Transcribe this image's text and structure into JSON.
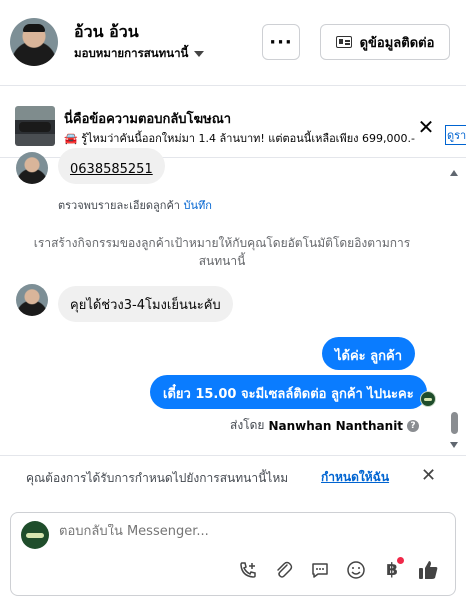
{
  "header": {
    "contact_name": "อ้วน อ้วน",
    "assign_label": "มอบหมายการสนทนานี้",
    "more_label": "···",
    "details_label": "ดูข้อมูลติดต่อ"
  },
  "ad": {
    "title": "นี่คือข้อความตอบกลับโฆษณา",
    "text": "🚘 รู้ไหมว่าคันนี้ออกใหม่มา 1.4 ล้านบาท! แต่ตอนนี้เหลือเพียง 699,000.-",
    "close": "✕",
    "link_label": "ดูรา"
  },
  "chat": {
    "phone_number": "0638585251",
    "review_text": "ตรวจพบรายละเอียดลูกค้า",
    "review_link": "บันทึก",
    "system_note": "เราสร้างกิจกรรมของลูกค้าเป้าหมายให้กับคุณโดยอัตโนมัติโดยอิงตามการสนทนานี้",
    "incoming_message": "คุยได้ช่วง3-4โมงเย็นนะคับ",
    "outgoing_messages": [
      "ได้ค่ะ ลูกค้า",
      "เดี๋ยว 15.00 จะมีเซลล์ติดต่อ ลูกค้า ไปนะคะ"
    ],
    "sent_by_label": "ส่งโดย",
    "sent_by_name": "Nanwhan Nanthanit"
  },
  "assign_prompt": {
    "text": "คุณต้องการได้รับการกำหนดไปยังการสนทนานี้ไหม",
    "link": "กำหนดให้ฉัน",
    "close": "✕"
  },
  "composer": {
    "placeholder": "ตอบกลับใน Messenger...",
    "tools": [
      "call-add-icon",
      "attachment-icon",
      "saved-reply-icon",
      "emoji-icon",
      "payment-icon",
      "like-icon"
    ]
  }
}
